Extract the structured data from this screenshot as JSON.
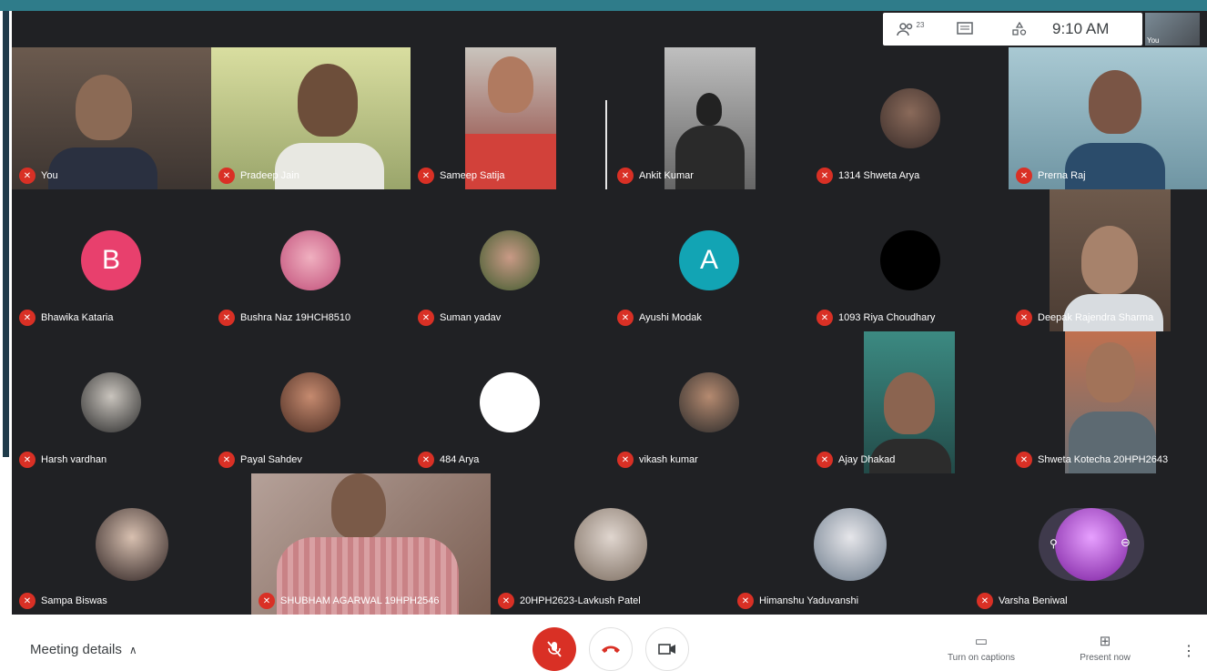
{
  "header": {
    "participants_count": "23",
    "time": "9:10 AM",
    "self_thumb_label": "You"
  },
  "participants": [
    {
      "name": "You"
    },
    {
      "name": "Pradeep Jain"
    },
    {
      "name": "Sameep Satija"
    },
    {
      "name": "Ankit Kumar"
    },
    {
      "name": "1314 Shweta Arya"
    },
    {
      "name": "Prerna Raj"
    },
    {
      "name": "Bhawika Kataria",
      "initial": "B"
    },
    {
      "name": "Bushra Naz 19HCH8510"
    },
    {
      "name": "Suman yadav"
    },
    {
      "name": "Ayushi Modak",
      "initial": "A"
    },
    {
      "name": "1093 Riya Choudhary"
    },
    {
      "name": "Deepak Rajendra Sharma"
    },
    {
      "name": "Harsh vardhan"
    },
    {
      "name": "Payal Sahdev"
    },
    {
      "name": "484 Arya"
    },
    {
      "name": "vikash kumar"
    },
    {
      "name": "Ajay Dhakad"
    },
    {
      "name": "Shweta Kotecha 20HPH2643"
    },
    {
      "name": "Sampa Biswas"
    },
    {
      "name": "SHUBHAM AGARWAL 19HPH2546"
    },
    {
      "name": "20HPH2623-Lavkush Patel"
    },
    {
      "name": "Himanshu Yaduvanshi"
    },
    {
      "name": "Varsha Beniwal"
    }
  ],
  "footer": {
    "meeting_details": "Meeting details",
    "captions_label": "Turn on captions",
    "present_label": "Present now"
  },
  "colors": {
    "mic_off_red": "#d93025",
    "stage_bg": "#202124",
    "avatar_b": "#e8406d",
    "avatar_a": "#12a4b4"
  }
}
